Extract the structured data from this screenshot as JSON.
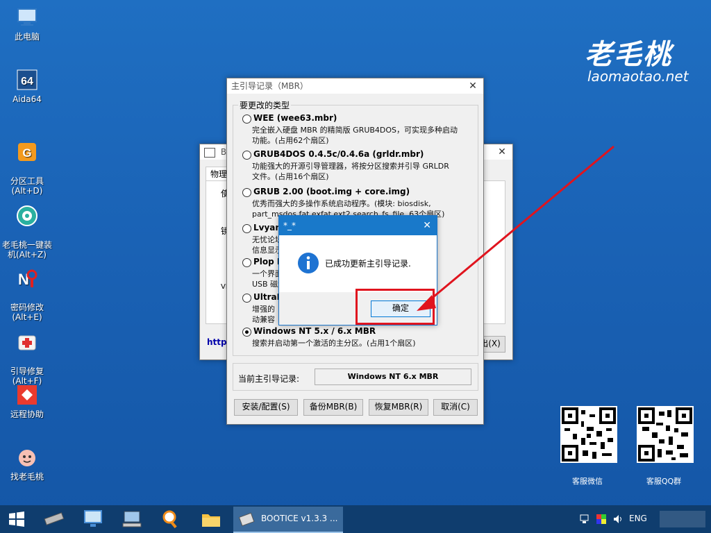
{
  "desktop": {
    "icons": [
      {
        "label": "此电脑",
        "icon": "computer-icon"
      },
      {
        "label": "Aida64",
        "icon": "aida64-icon"
      },
      {
        "label": "分区工具\n(Alt+D)",
        "icon": "partition-tool-icon"
      },
      {
        "label": "老毛桃一键装\n机(Alt+Z)",
        "icon": "one-click-install-icon"
      },
      {
        "label": "密码修改\n(Alt+E)",
        "icon": "password-change-icon"
      },
      {
        "label": "引导修复\n(Alt+F)",
        "icon": "boot-repair-icon"
      },
      {
        "label": "远程协助",
        "icon": "remote-assist-icon"
      },
      {
        "label": "找老毛桃",
        "icon": "find-laomaotao-icon"
      }
    ],
    "brand_logo": "老毛桃",
    "brand_url": "laomaotao.net",
    "qr_codes": [
      {
        "caption": "客服微信"
      },
      {
        "caption": "客服QQ群"
      }
    ]
  },
  "bootice_window": {
    "title": "BOOTICE v1.3.3",
    "title_short": "BO",
    "tab_label": "物理",
    "label_1": "使",
    "label_2": "镜",
    "label_3": "VH",
    "link_partial": "http:",
    "exit_partial": "出(X)"
  },
  "mbr_dialog": {
    "title": "主引导记录（MBR）",
    "group_label": "要更改的类型",
    "options": [
      {
        "title": "WEE (wee63.mbr)",
        "desc": "完全嵌入硬盘 MBR 的精简版 GRUB4DOS，可实现多种启动\n功能。(占用62个扇区)",
        "selected": false
      },
      {
        "title": "GRUB4DOS 0.4.5c/0.4.6a (grldr.mbr)",
        "desc": "功能强大的开源引导管理器，将按分区搜索并引导 GRLDR\n文件。(占用16个扇区)",
        "selected": false
      },
      {
        "title": "GRUB 2.00 (boot.img + core.img)",
        "desc": "优秀而强大的多操作系统启动程序。(模块: biosdisk,\npart_msdos fat exfat ext2 search_fs_file, 63个扇区)",
        "selected": false
      },
      {
        "title": "Lvyana",
        "desc": "无忧论坛                                                    文提示\n信息显示",
        "selected": false
      },
      {
        "title": "Plop Bo",
        "desc": "一个界面                                                    盘/\nUSB 磁盘",
        "selected": false
      },
      {
        "title": "UltraIS",
        "desc": "增强的                                                  了启\n动兼容",
        "selected": false
      },
      {
        "title": "Windows NT 5.x / 6.x MBR",
        "desc": "搜索并启动第一个激活的主分区。(占用1个扇区)",
        "selected": true
      }
    ],
    "current_label": "当前主引导记录:",
    "current_value": "Windows NT 6.x MBR",
    "buttons": [
      "安装/配置(S)",
      "备份MBR(B)",
      "恢复MBR(R)",
      "取消(C)"
    ]
  },
  "message_box": {
    "title": "*_*",
    "message": "已成功更新主引导记录.",
    "ok_label": "确定"
  },
  "taskbar": {
    "active_task": "BOOTICE v1.3.3 ...",
    "language": "ENG"
  },
  "colors": {
    "highlight_red": "#e0141e",
    "desktop_blue": "#1a62b5",
    "info_blue": "#1e73d2"
  }
}
